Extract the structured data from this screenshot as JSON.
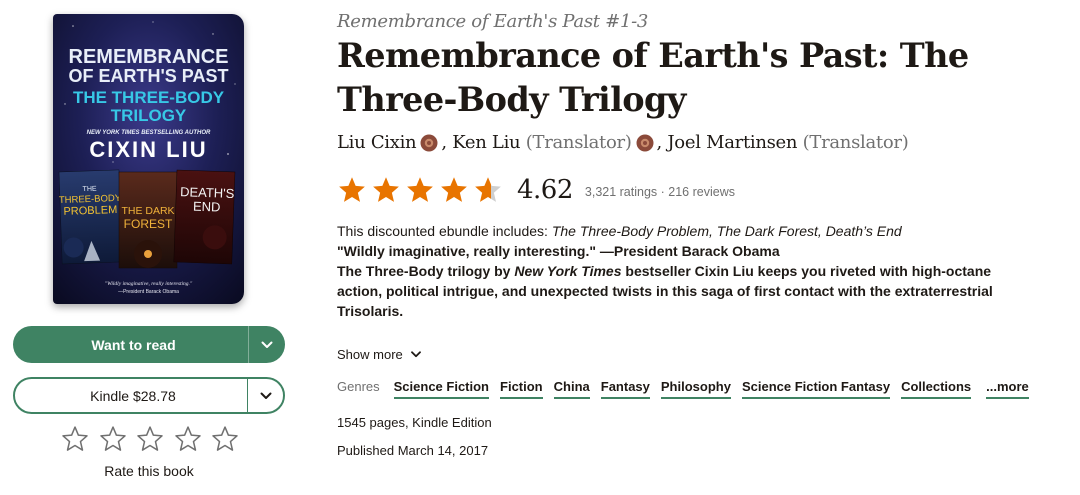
{
  "cover": {
    "title_line1": "REMEMBRANCE",
    "title_line2": "OF EARTH'S PAST",
    "subtitle_line1": "THE THREE-BODY",
    "subtitle_line2": "TRILOGY",
    "tagline": "NEW YORK TIMES BESTSELLING AUTHOR",
    "author": "CIXIN LIU",
    "book1_line1": "THE",
    "book1_line2": "THREE-BODY",
    "book1_line3": "PROBLEM",
    "book2_line1": "THE DARK",
    "book2_line2": "FOREST",
    "book3_line1": "DEATH'S",
    "book3_line2": "END",
    "quote": "\"Wildly imaginative, really interesting.\"",
    "quote_attr": "—President Barack Obama"
  },
  "actions": {
    "want_to_read": "Want to read",
    "kindle_price": "Kindle $28.78",
    "rate_label": "Rate this book",
    "rate_stars": 5
  },
  "book": {
    "series": "Remembrance of Earth's Past #1-3",
    "title": "Remembrance of Earth's Past: The Three-Body Trilogy",
    "authors": [
      {
        "name": "Liu Cixin",
        "role": ""
      },
      {
        "name": "Ken Liu",
        "role": "(Translator)"
      },
      {
        "name": "Joel Martinsen",
        "role": "(Translator)"
      }
    ],
    "author1_name": "Liu Cixin",
    "author2_name": "Ken Liu",
    "author2_role": "(Translator)",
    "author3_name": "Joel Martinsen",
    "author3_role": "(Translator)",
    "rating": "4.62",
    "rating_fill": 0.62,
    "ratings_count": "3,321 ratings",
    "reviews_count": "216 reviews",
    "meta_sep": " · ",
    "desc_intro": "This discounted ebundle includes: ",
    "desc_titles": "The Three-Body Problem, The Dark Forest, Death’s End",
    "desc_quote": "\"Wildly imaginative, really interesting.\" —President Barack Obama",
    "desc_p3_a": "The Three-Body trilogy by ",
    "desc_p3_b": "New York Times",
    "desc_p3_c": " bestseller Cixin Liu keeps you riveted with high-octane action, political intrigue, and unexpected twists in this saga of first contact with the extraterrestrial Trisolaris.",
    "show_more": "Show more",
    "genres_label": "Genres",
    "genres": [
      "Science Fiction",
      "Fiction",
      "China",
      "Fantasy",
      "Philosophy",
      "Science Fiction Fantasy",
      "Collections"
    ],
    "genres_more": "...more",
    "pages": "1545 pages, Kindle Edition",
    "published": "Published March 14, 2017"
  },
  "colors": {
    "accent": "#3f8363",
    "star": "#e87400",
    "text": "#1e1915",
    "muted": "#707070",
    "badge": "#8b4a3a"
  },
  "icons": {
    "dropdown": "chevron-down-icon",
    "star": "star-icon",
    "badge": "goodreads-author-badge-icon"
  }
}
